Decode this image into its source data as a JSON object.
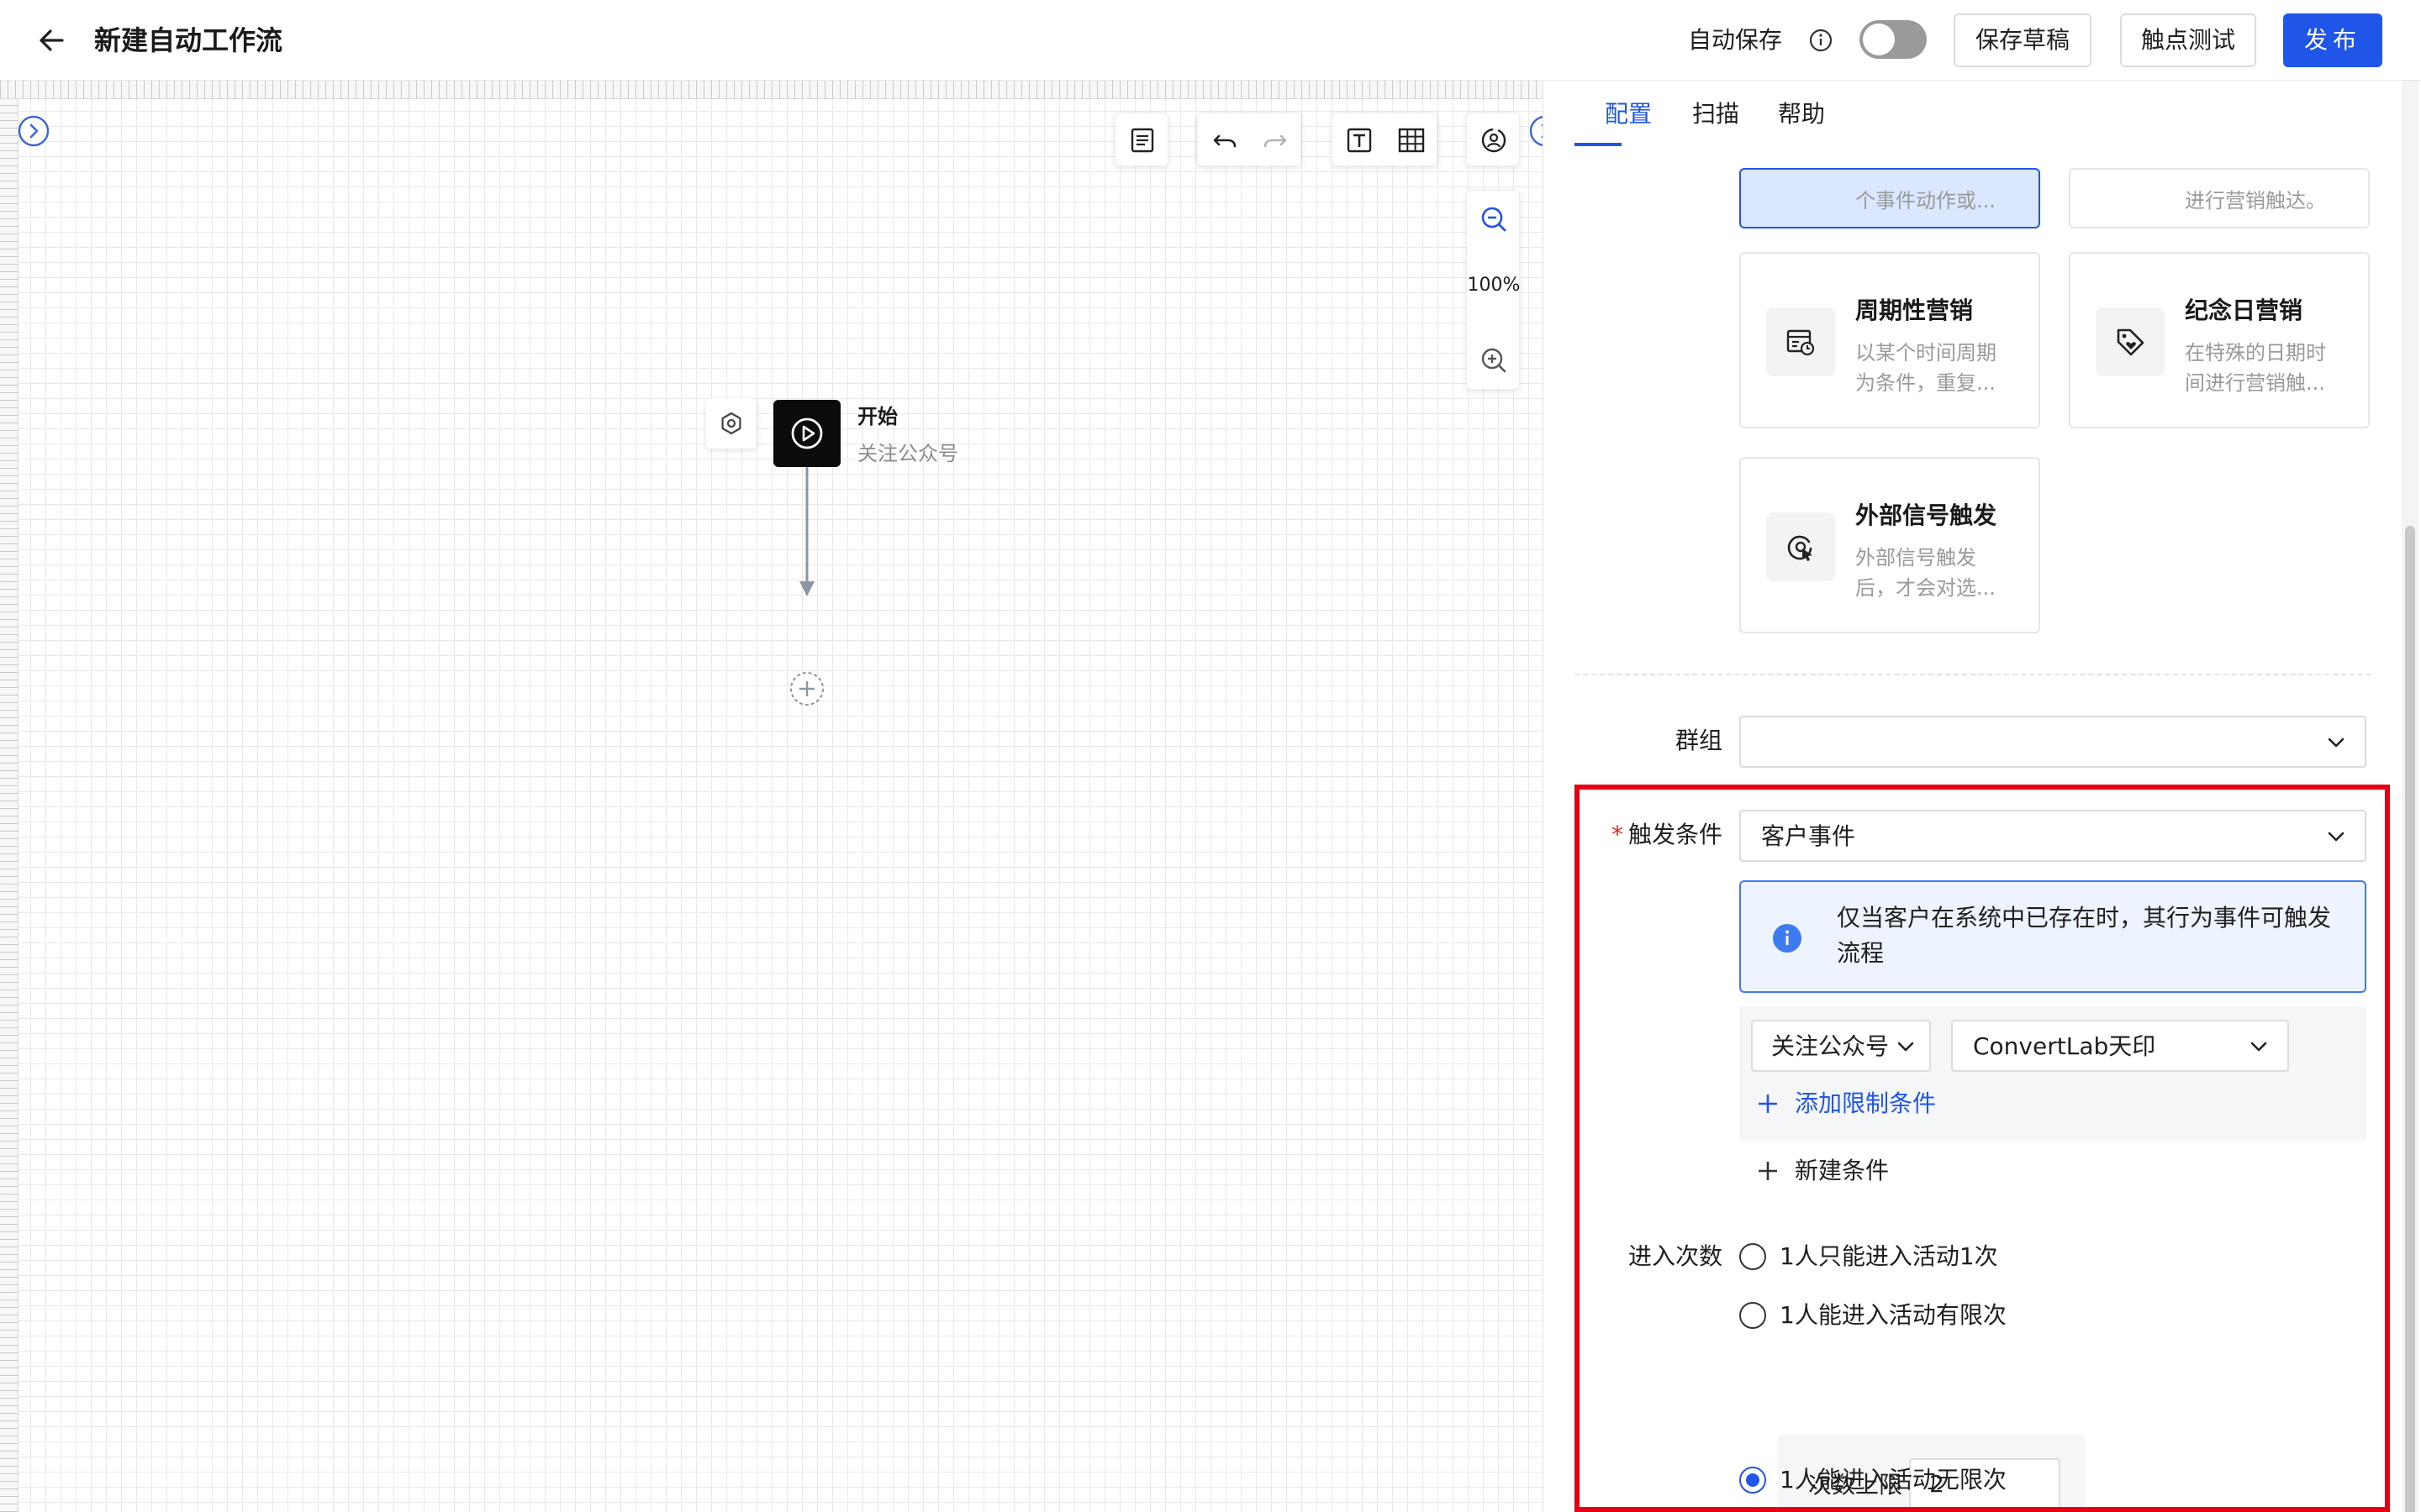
{
  "header": {
    "title": "新建自动工作流",
    "autosave_label": "自动保存",
    "autosave_enabled": false,
    "save_draft": "保存草稿",
    "touch_test": "触点测试",
    "publish": "发布"
  },
  "canvas": {
    "zoom": "100%",
    "start_node": {
      "title": "开始",
      "subtitle": "关注公众号"
    }
  },
  "panel": {
    "tabs": [
      {
        "label": "配置",
        "active": true
      },
      {
        "label": "扫描",
        "active": false
      },
      {
        "label": "帮助",
        "active": false
      }
    ],
    "cards": [
      {
        "title": "",
        "desc": "个事件动作或...",
        "selected": true
      },
      {
        "title": "",
        "desc": "进行营销触达。",
        "selected": false
      },
      {
        "title": "周期性营销",
        "desc": "以某个时间周期为条件，重复...",
        "icon": "calendar-clock-icon"
      },
      {
        "title": "纪念日营销",
        "desc": "在特殊的日期时间进行营销触...",
        "icon": "tag-heart-icon"
      },
      {
        "title": "外部信号触发",
        "desc": "外部信号触发后，才会对选...",
        "icon": "signal-target-icon"
      }
    ],
    "group": {
      "label": "群组",
      "value": ""
    },
    "trigger": {
      "label": "触发条件",
      "required_mark": "*",
      "value": "客户事件",
      "alert": "仅当客户在系统中已存在时，其行为事件可触发流程",
      "event_select": "关注公众号",
      "account_select": "ConvertLab天印",
      "add_limit": "添加限制条件",
      "new_condition": "新建条件"
    },
    "entry": {
      "label": "进入次数",
      "options": [
        {
          "label": "1人只能进入活动1次",
          "selected": false
        },
        {
          "label": "1人能进入活动有限次",
          "selected": false
        },
        {
          "label": "1人能进入活动无限次",
          "selected": true
        }
      ],
      "limit_label": "次数上限",
      "limit_value": "2"
    }
  },
  "colors": {
    "accent": "#1f56e8",
    "highlight_border": "#e60012",
    "alert_bg": "#eef4ff",
    "selected_card_bg": "#dbe7ff"
  }
}
